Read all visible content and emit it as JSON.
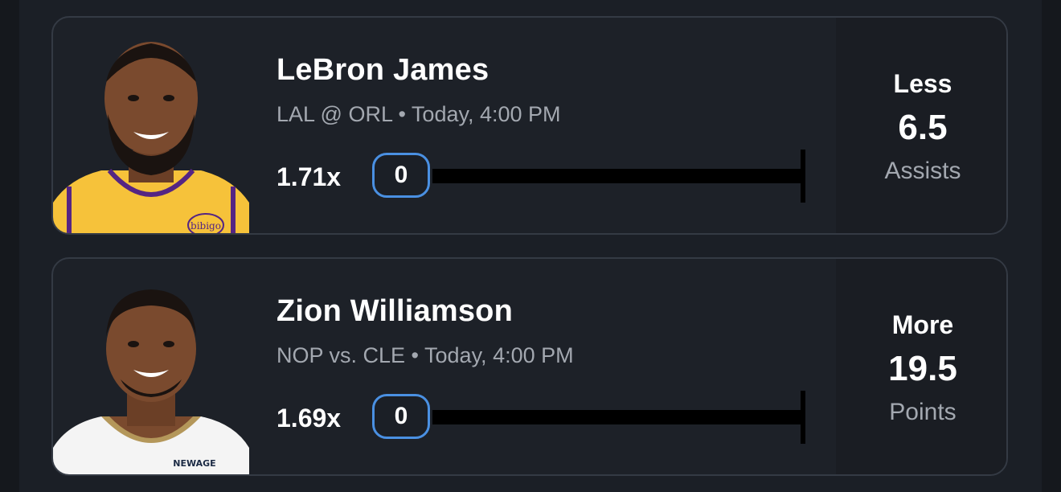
{
  "picks": [
    {
      "player_name": "LeBron James",
      "matchup": "LAL @ ORL • Today, 4:00 PM",
      "multiplier": "1.71x",
      "current_value": "0",
      "progress": 0,
      "direction": "Less",
      "line": "6.5",
      "stat": "Assists",
      "jersey_color": "#f6c23a",
      "jersey_trim": "#552583",
      "jersey_badge_text": "bibigo"
    },
    {
      "player_name": "Zion Williamson",
      "matchup": "NOP vs. CLE • Today, 4:00 PM",
      "multiplier": "1.69x",
      "current_value": "0",
      "progress": 0,
      "direction": "More",
      "line": "19.5",
      "stat": "Points",
      "jersey_color": "#f4f4f4",
      "jersey_trim": "#b4975a",
      "jersey_badge_text": "NEWAGE"
    }
  ]
}
